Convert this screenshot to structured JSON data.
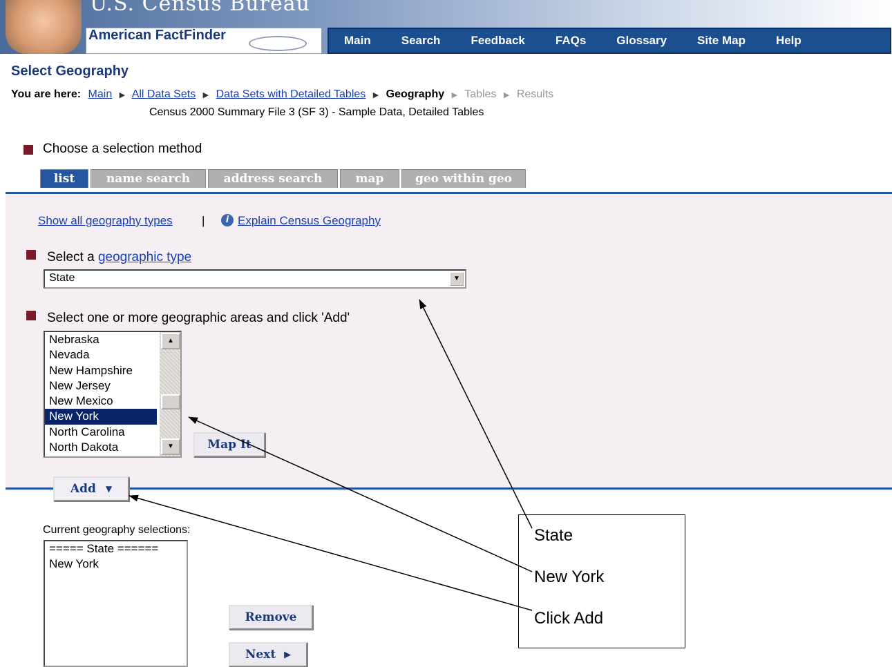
{
  "header": {
    "agency": "U.S. Census Bureau",
    "product": "American FactFinder",
    "nav": [
      "Main",
      "Search",
      "Feedback",
      "FAQs",
      "Glossary",
      "Site Map",
      "Help"
    ]
  },
  "page_title": "Select Geography",
  "breadcrumb": {
    "label": "You are here:",
    "links": [
      "Main",
      "All Data Sets",
      "Data Sets with Detailed Tables"
    ],
    "current": "Geography",
    "upcoming": [
      "Tables",
      "Results"
    ]
  },
  "dataset": "Census 2000 Summary File 3 (SF 3) - Sample Data, Detailed Tables",
  "method": {
    "heading": "Choose a selection method",
    "tabs": [
      "list",
      "name search",
      "address search",
      "map",
      "geo within geo"
    ],
    "active_tab": "list"
  },
  "links": {
    "show_all": "Show all geography types",
    "divider": "|",
    "explain": "Explain Census Geography"
  },
  "geo_type": {
    "prefix": "Select a ",
    "link": "geographic type",
    "value": "State"
  },
  "areas": {
    "heading": "Select one or more geographic areas and click 'Add'",
    "items": [
      "Nebraska",
      "Nevada",
      "New Hampshire",
      "New Jersey",
      "New Mexico",
      "New York",
      "North Carolina",
      "North Dakota"
    ],
    "selected": "New York"
  },
  "buttons": {
    "map_it": "Map It",
    "add": "Add",
    "remove": "Remove",
    "next": "Next"
  },
  "current": {
    "label": "Current geography selections:",
    "items": [
      "===== State ======",
      "New York"
    ]
  },
  "callout": [
    "State",
    "New York",
    "Click Add"
  ],
  "colors": {
    "nav_bg": "#1c4f8f",
    "tab_active": "#2457a0",
    "bullet": "#7a1a2a",
    "panel_bg": "#f5eef3"
  }
}
